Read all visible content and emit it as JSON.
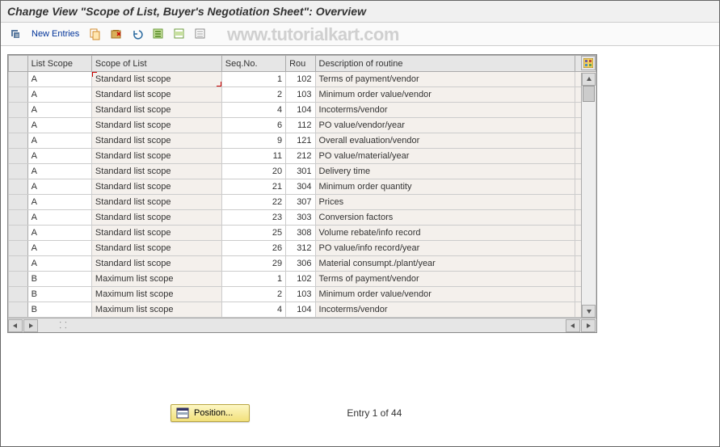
{
  "title": "Change View \"Scope of List, Buyer's Negotiation Sheet\": Overview",
  "watermark": "www.tutorialkart.com",
  "toolbar": {
    "new_entries": "New Entries"
  },
  "columns": {
    "list_scope": "List Scope",
    "scope_of_list": "Scope of List",
    "seq_no": "Seq.No.",
    "rou": "Rou",
    "description": "Description of routine"
  },
  "rows": [
    {
      "ls": "A",
      "scope": "Standard list scope",
      "seq": "1",
      "rou": "102",
      "desc": "Terms of payment/vendor"
    },
    {
      "ls": "A",
      "scope": "Standard list scope",
      "seq": "2",
      "rou": "103",
      "desc": "Minimum order value/vendor"
    },
    {
      "ls": "A",
      "scope": "Standard list scope",
      "seq": "4",
      "rou": "104",
      "desc": "Incoterms/vendor"
    },
    {
      "ls": "A",
      "scope": "Standard list scope",
      "seq": "6",
      "rou": "112",
      "desc": "PO value/vendor/year"
    },
    {
      "ls": "A",
      "scope": "Standard list scope",
      "seq": "9",
      "rou": "121",
      "desc": "Overall evaluation/vendor"
    },
    {
      "ls": "A",
      "scope": "Standard list scope",
      "seq": "11",
      "rou": "212",
      "desc": "PO value/material/year"
    },
    {
      "ls": "A",
      "scope": "Standard list scope",
      "seq": "20",
      "rou": "301",
      "desc": "Delivery time"
    },
    {
      "ls": "A",
      "scope": "Standard list scope",
      "seq": "21",
      "rou": "304",
      "desc": "Minimum order quantity"
    },
    {
      "ls": "A",
      "scope": "Standard list scope",
      "seq": "22",
      "rou": "307",
      "desc": "Prices"
    },
    {
      "ls": "A",
      "scope": "Standard list scope",
      "seq": "23",
      "rou": "303",
      "desc": "Conversion factors"
    },
    {
      "ls": "A",
      "scope": "Standard list scope",
      "seq": "25",
      "rou": "308",
      "desc": "Volume rebate/info record"
    },
    {
      "ls": "A",
      "scope": "Standard list scope",
      "seq": "26",
      "rou": "312",
      "desc": "PO value/info record/year"
    },
    {
      "ls": "A",
      "scope": "Standard list scope",
      "seq": "29",
      "rou": "306",
      "desc": "Material consumpt./plant/year"
    },
    {
      "ls": "B",
      "scope": "Maximum list scope",
      "seq": "1",
      "rou": "102",
      "desc": "Terms of payment/vendor"
    },
    {
      "ls": "B",
      "scope": "Maximum list scope",
      "seq": "2",
      "rou": "103",
      "desc": "Minimum order value/vendor"
    },
    {
      "ls": "B",
      "scope": "Maximum list scope",
      "seq": "4",
      "rou": "104",
      "desc": "Incoterms/vendor"
    }
  ],
  "footer": {
    "position_label": "Position...",
    "entry_status": "Entry 1 of 44"
  }
}
